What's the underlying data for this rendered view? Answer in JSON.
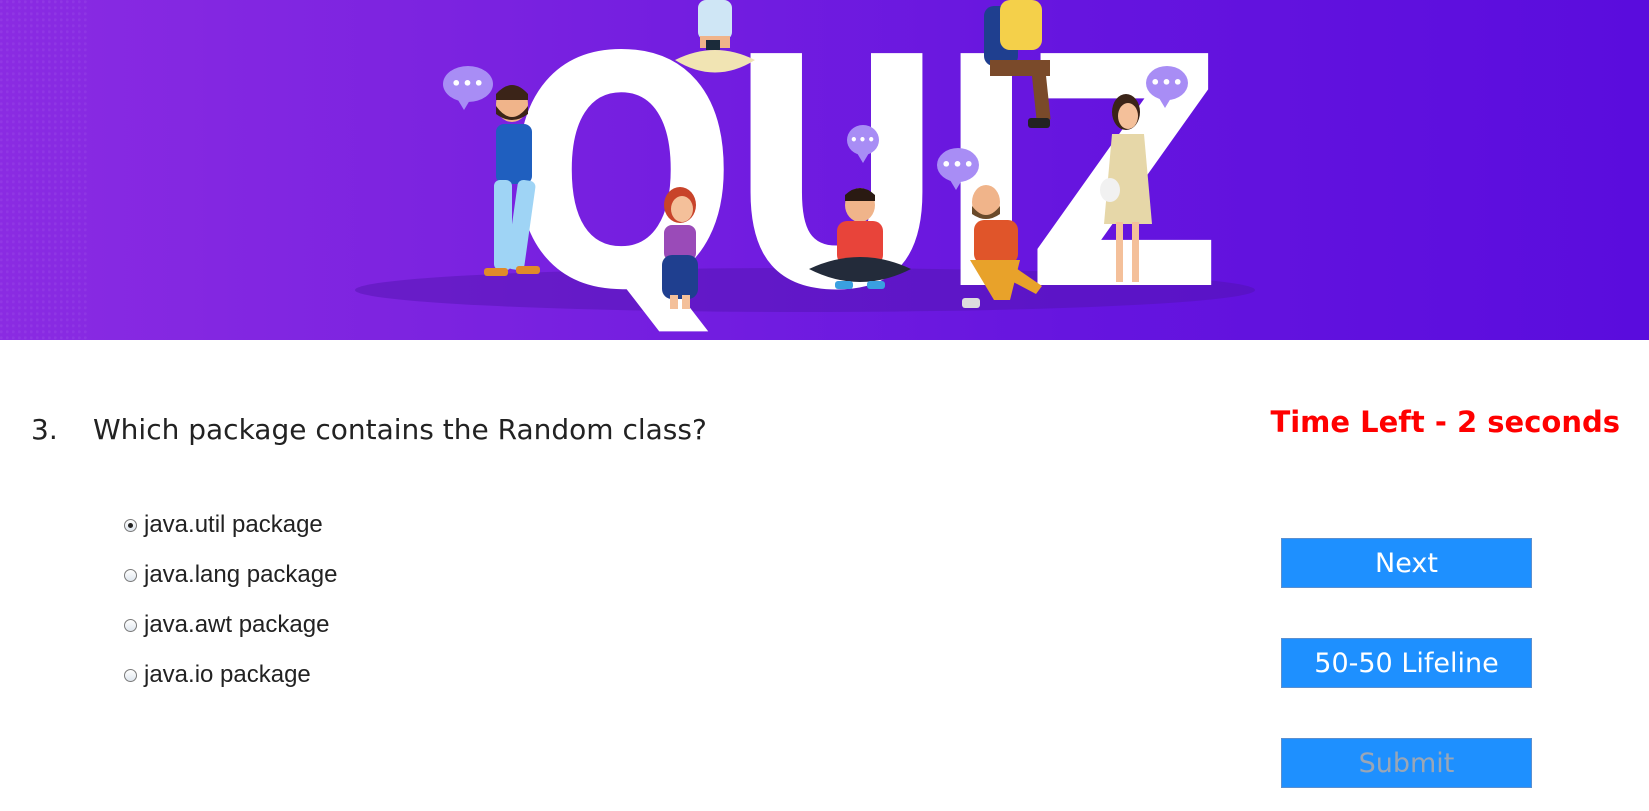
{
  "banner": {
    "title": "QUIZ",
    "bubble_text": "•••"
  },
  "question": {
    "number": "3.",
    "text": "Which package contains the Random class?"
  },
  "timer": {
    "text": "Time Left - 2 seconds",
    "color": "#ff0000"
  },
  "options": [
    {
      "label": "java.util package",
      "selected": true
    },
    {
      "label": "java.lang package",
      "selected": false
    },
    {
      "label": "java.awt package",
      "selected": false
    },
    {
      "label": "java.io package",
      "selected": false
    }
  ],
  "buttons": {
    "next": "Next",
    "lifeline": "50-50 Lifeline",
    "submit": "Submit"
  },
  "colors": {
    "button_bg": "#1e90ff",
    "banner_gradient_start": "#8a2be2",
    "banner_gradient_end": "#5a0cdd"
  }
}
